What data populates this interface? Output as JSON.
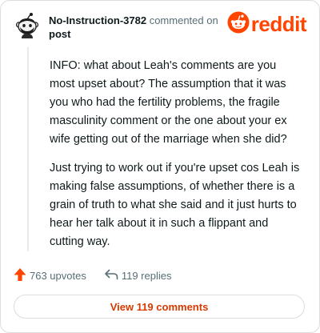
{
  "header": {
    "username": "No-Instruction-3782",
    "action_text": "commented on",
    "target_text": "post",
    "logo_text": "reddit",
    "avatar_icon": "snoo-avatar-icon",
    "logo_icon": "reddit-snoo-icon"
  },
  "comment": {
    "paragraphs": [
      "INFO: what about Leah's comments are you most upset about? The assumption that it was you who had the fertility problems, the fragile masculinity comment or the one about your ex wife getting out of the marriage when she did?",
      "Just trying to work out if you're upset cos Leah is making false assumptions, of whether there is a grain of truth to what she said and it just hurts to hear her talk about it in such a flippant and cutting way."
    ]
  },
  "stats": {
    "upvotes": "763 upvotes",
    "upvote_icon": "upvote-arrow-icon",
    "replies": "119 replies",
    "reply_icon": "reply-arrow-icon"
  },
  "footer": {
    "view_comments_label": "View 119 comments"
  },
  "colors": {
    "brand": "#ff4500",
    "link_button_text": "#d93a00",
    "muted_text": "#576f76",
    "body_text": "#0f1a1c",
    "border": "#dadde1"
  }
}
